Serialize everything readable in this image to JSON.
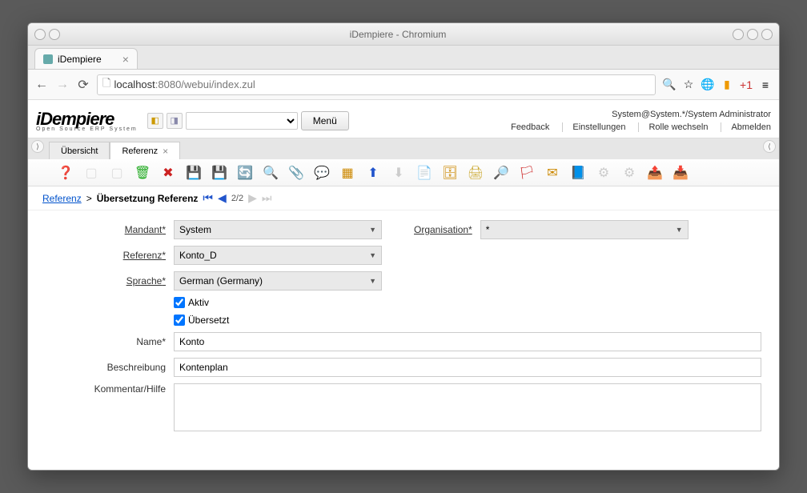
{
  "window": {
    "title": "iDempiere - Chromium"
  },
  "browser": {
    "tab_title": "iDempiere",
    "url_host": "localhost",
    "url_port_path": ":8080/webui/index.zul"
  },
  "header": {
    "logo": "iDempiere",
    "logo_sub": "Open Source ERP System",
    "menu_button": "Menü",
    "user_context": "System@System.*/System Administrator",
    "links": {
      "feedback": "Feedback",
      "settings": "Einstellungen",
      "switch_role": "Rolle wechseln",
      "logout": "Abmelden"
    }
  },
  "tabs": {
    "overview": "Übersicht",
    "reference": "Referenz"
  },
  "breadcrumb": {
    "root": "Referenz",
    "sep": ">",
    "current": "Übersetzung Referenz",
    "page": "2/2"
  },
  "form": {
    "mandant_label": "Mandant",
    "mandant_value": "System",
    "organisation_label": "Organisation",
    "organisation_value": "*",
    "referenz_label": "Referenz",
    "referenz_value": "Konto_D",
    "sprache_label": "Sprache",
    "sprache_value": "German (Germany)",
    "aktiv_label": "Aktiv",
    "uebersetzt_label": "Übersetzt",
    "name_label": "Name",
    "name_value": "Konto",
    "beschreibung_label": "Beschreibung",
    "beschreibung_value": "Kontenplan",
    "kommentar_label": "Kommentar/Hilfe",
    "kommentar_value": ""
  }
}
